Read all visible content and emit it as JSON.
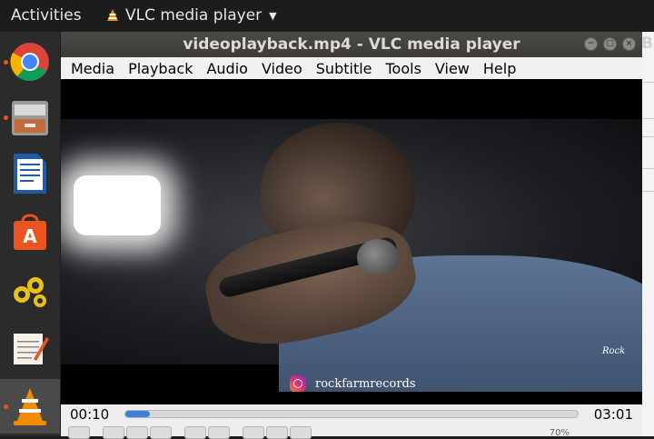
{
  "topbar": {
    "activities": "Activities",
    "app_name": "VLC media player"
  },
  "dock": {
    "items": [
      "chrome-icon",
      "files-icon",
      "writer-icon",
      "software-center-icon",
      "settings-icon",
      "text-editor-icon",
      "vlc-icon"
    ]
  },
  "window": {
    "title": "videoplayback.mp4 - VLC media player",
    "menu": [
      "Media",
      "Playback",
      "Audio",
      "Video",
      "Subtitle",
      "Tools",
      "View",
      "Help"
    ]
  },
  "video": {
    "overlay_handle": "rockfarmrecords",
    "corner_logo": "Rock"
  },
  "controls": {
    "elapsed": "00:10",
    "total": "03:01",
    "progress": 0.055,
    "volume": "70%"
  },
  "colors": {
    "accent": "#3c82d4",
    "ubuntu_orange": "#e95420"
  },
  "background_window_title_fragment": "Ba"
}
